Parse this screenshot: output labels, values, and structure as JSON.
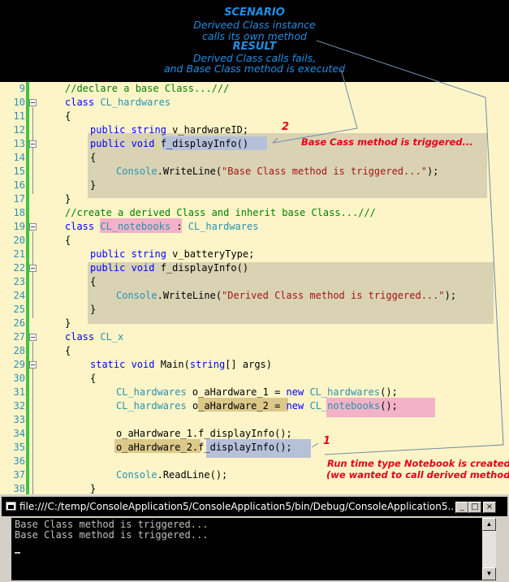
{
  "banner": {
    "l1": "SCENARIO",
    "l2": "Deriveed Class instance",
    "l3": "calls its own method",
    "l4": "RESULT",
    "l5": "Derived Class calls fails,",
    "l6": "and Base Class method is executed"
  },
  "editor": {
    "line_numbers": [
      "9",
      "10",
      "11",
      "12",
      "13",
      "14",
      "15",
      "16",
      "17",
      "18",
      "19",
      "20",
      "21",
      "22",
      "23",
      "24",
      "25",
      "26",
      "27",
      "28",
      "29",
      "30",
      "31",
      "32",
      "33",
      "34",
      "35",
      "36",
      "37",
      "38"
    ],
    "code": {
      "c9_comment": "//declare a base Class...///",
      "c10_kw": "class",
      "c10_name": "CL_hardwares",
      "c11": "{",
      "c12_kw": "public string",
      "c12_rest": " v_hardwareID;",
      "c13_kw": "public void",
      "c13_method": "f_displayInfo()",
      "c14": "{",
      "c15_type": "Console",
      "c15_dot": ".",
      "c15_method": "WriteLine(",
      "c15_str": "\"Base Class method is triggered...\"",
      "c15_end": ");",
      "c16": "}",
      "c17": "}",
      "c18_comment": "//create a derived Class and inherit base Class...///",
      "c19_kw": "class",
      "c19_name": "CL_notebooks",
      "c19_colon": " : ",
      "c19_base": "CL_hardwares",
      "c20": "{",
      "c21_kw": "public string",
      "c21_rest": " v_batteryType;",
      "c22_kw": "public void",
      "c22_rest": " f_displayInfo()",
      "c23": "{",
      "c24_type": "Console",
      "c24_dot": ".",
      "c24_method": "WriteLine(",
      "c24_str": "\"Derived Class method is triggered...\"",
      "c24_end": ");",
      "c25": "}",
      "c26": "}",
      "c27_kw": "class",
      "c27_name": "CL_x",
      "c28": "{",
      "c29_kw": "static void",
      "c29_mid": " Main(",
      "c29_kw2": "string",
      "c29_end": "[] args)",
      "c30": "{",
      "c31_type": "CL_hardwares",
      "c31_var": " o_aHardware_1 ",
      "c31_eq": "=",
      "c31_new": " new ",
      "c31_type2": "CL_hardwares",
      "c31_end": "();",
      "c32_type": "CL_hardwares",
      "c32_var": "o_aHardware_2",
      "c32_eq": "=",
      "c32_new": "new",
      "c32_type2": "CL_notebooks",
      "c32_end": "();",
      "c34": "o_aHardware_1.f_displayInfo();",
      "c35_var": "o_aHardware_2",
      "c35_dot": ".",
      "c35_method": "f_displayInfo();",
      "c37_type": "Console",
      "c37_dot": ".",
      "c37_rest": "ReadLine();",
      "c38": "}"
    },
    "annotations": {
      "num2": "2",
      "note2": "Base Cass method is triggered...",
      "num1": "1",
      "note1a": "Run time type Notebook is created",
      "note1b": "(we wanted to call derived method)"
    }
  },
  "console": {
    "title": "file:///C:/temp/ConsoleApplication5/ConsoleApplication5/bin/Debug/ConsoleApplication5....",
    "minimize": "_",
    "maximize": "□",
    "close": "×",
    "output": [
      "Base Class method is triggered...",
      "Base Class method is triggered..."
    ],
    "scroll_up": "▲",
    "scroll_down": "▼"
  },
  "colors": {
    "annotation": "#e8001a",
    "banner_text": "#1e8fe6",
    "editor_bg": "#fdf5c8"
  }
}
